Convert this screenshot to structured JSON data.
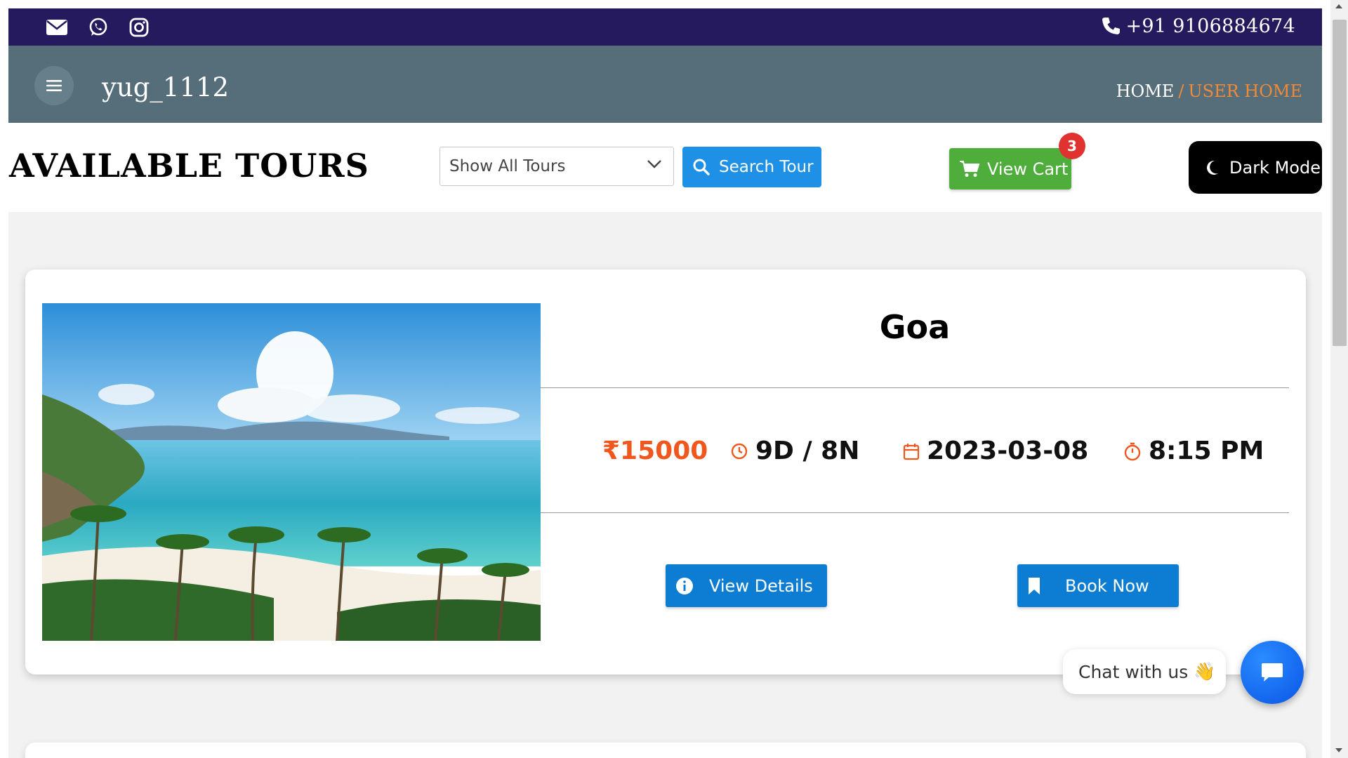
{
  "topbar": {
    "icons": [
      "envelope-icon",
      "whatsapp-icon",
      "instagram-icon"
    ],
    "phone": "+91 9106884674",
    "bg_color": "#261a5e"
  },
  "nav": {
    "username": "yug_1112",
    "breadcrumb": {
      "home": "HOME",
      "separator": "/",
      "current": "USER HOME"
    },
    "bg_color": "#566e79",
    "accent_color": "#f08a3a"
  },
  "toolbar": {
    "title": "AVAILABLE TOURS",
    "filter_selected": "Show All Tours",
    "search_label": "Search Tour",
    "cart_label": "View Cart",
    "cart_count": "3",
    "dark_mode_label": "Dark Mode"
  },
  "tours": [
    {
      "name": "Goa",
      "price": "₹15000",
      "duration": "9D / 8N",
      "date": "2023-03-08",
      "time": "8:15 PM",
      "details_label": "View Details",
      "book_label": "Book Now"
    }
  ],
  "chat": {
    "label": "Chat with us",
    "emoji": "👋"
  },
  "colors": {
    "price": "#f0571f",
    "primary_button": "#0d7dd3",
    "search_button": "#1e90e6",
    "cart_button": "#4fad3c",
    "badge": "#e0322f"
  }
}
